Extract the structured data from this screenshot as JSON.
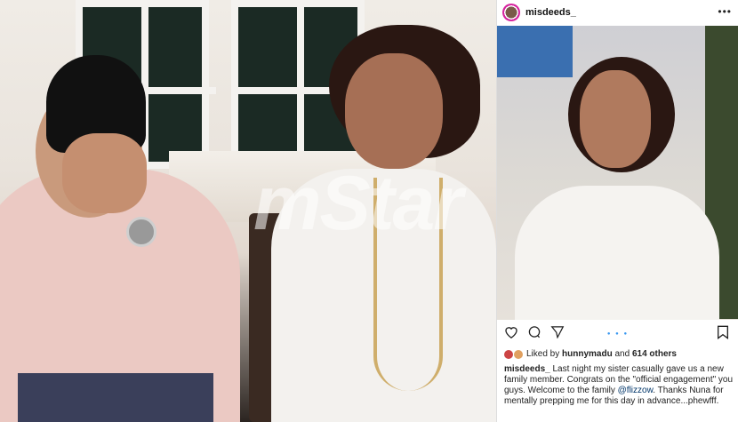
{
  "watermark": "mStar",
  "post": {
    "username": "misdeeds_",
    "more_label": "•••",
    "likes_prefix": "Liked by",
    "likes_user": "hunnymadu",
    "likes_and": "and",
    "likes_count": "614 others",
    "caption_user": "misdeeds_",
    "caption_text_1": "Last night my sister casually gave us a new family member. Congrats on the \"official engagement\" you guys. Welcome to the family",
    "caption_mention": "@flizzow",
    "caption_text_2": ". Thanks Nuna for mentally prepping me for this day in advance...phewfff."
  },
  "icons": {
    "like": "heart-icon",
    "comment": "comment-icon",
    "share": "send-icon",
    "save": "bookmark-icon"
  },
  "colors": {
    "link": "#003569",
    "dots": "#3897f0"
  }
}
